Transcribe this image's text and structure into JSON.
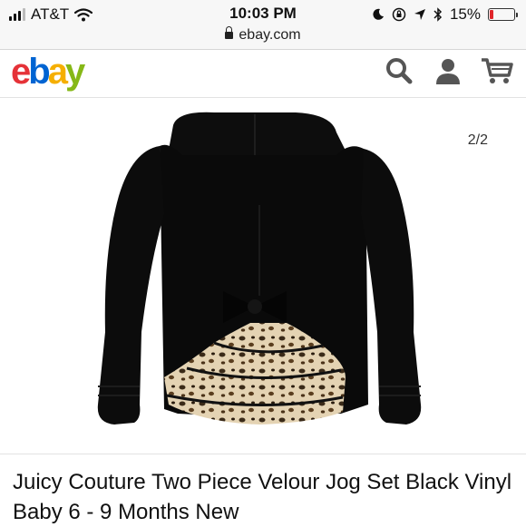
{
  "status_bar": {
    "carrier": "AT&T",
    "time": "10:03 PM",
    "battery_percent": "15%",
    "battery_level": 0.15
  },
  "url_bar": {
    "url": "ebay.com"
  },
  "header": {
    "logo": {
      "e": "e",
      "b": "b",
      "a": "a",
      "y": "y"
    }
  },
  "gallery": {
    "pager": "2/2"
  },
  "product": {
    "title": "Juicy Couture Two Piece Velour Jog Set Black Vinyl Baby 6 - 9 Months New"
  },
  "colors": {
    "ebay_red": "#e53238",
    "ebay_blue": "#0064d2",
    "ebay_yellow": "#f5af02",
    "ebay_green": "#86b817",
    "battery_low": "#e0262b"
  },
  "icons": [
    "signal-icon",
    "wifi-icon",
    "lock-icon",
    "moon-icon",
    "rotation-lock-icon",
    "location-icon",
    "bluetooth-icon",
    "battery-icon",
    "search-icon",
    "user-icon",
    "cart-icon"
  ]
}
